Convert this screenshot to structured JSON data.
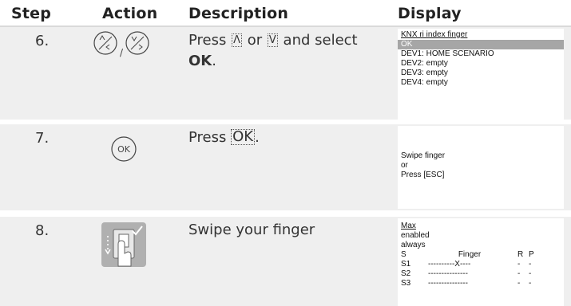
{
  "header": {
    "step": "Step",
    "action": "Action",
    "description": "Description",
    "display": "Display"
  },
  "rows": [
    {
      "step": "6.",
      "action_icons": [
        "up-down-scroll-key-icon",
        "right-scroll-key-icon"
      ],
      "action_separator": "/",
      "description": {
        "prefix": "Press",
        "key1": "Λ",
        "middle": "or",
        "key2": "V",
        "suffix": "and select",
        "bold": "OK",
        "end": "."
      },
      "display": {
        "title": "KNX ri index finger",
        "selected": "OK",
        "lines": [
          "DEV1: HOME SCENARIO",
          "DEV2: empty",
          "DEV3: empty",
          "DEV4: empty"
        ]
      }
    },
    {
      "step": "7.",
      "action_icons": [
        "ok-key-icon"
      ],
      "action_key_label": "OK",
      "description": {
        "prefix": "Press",
        "key": "OK",
        "end": "."
      },
      "display": {
        "lines": [
          "Swipe finger",
          "or",
          "Press [ESC]"
        ]
      }
    },
    {
      "step": "8.",
      "action_icons": [
        "finger-scanner-swipe-icon"
      ],
      "description": {
        "text": "Swipe your finger"
      },
      "display": {
        "title": "Max",
        "lines": [
          "enabled",
          "always"
        ],
        "table_header": {
          "s": "S",
          "finger": "Finger",
          "r": "R",
          "p": "P"
        },
        "table_rows": [
          {
            "s": "S1",
            "finger": "----------X----",
            "r": "-",
            "p": "-"
          },
          {
            "s": "S2",
            "finger": "---------------",
            "r": "-",
            "p": "-"
          },
          {
            "s": "S3",
            "finger": "---------------",
            "r": "-",
            "p": "-"
          }
        ]
      }
    }
  ]
}
